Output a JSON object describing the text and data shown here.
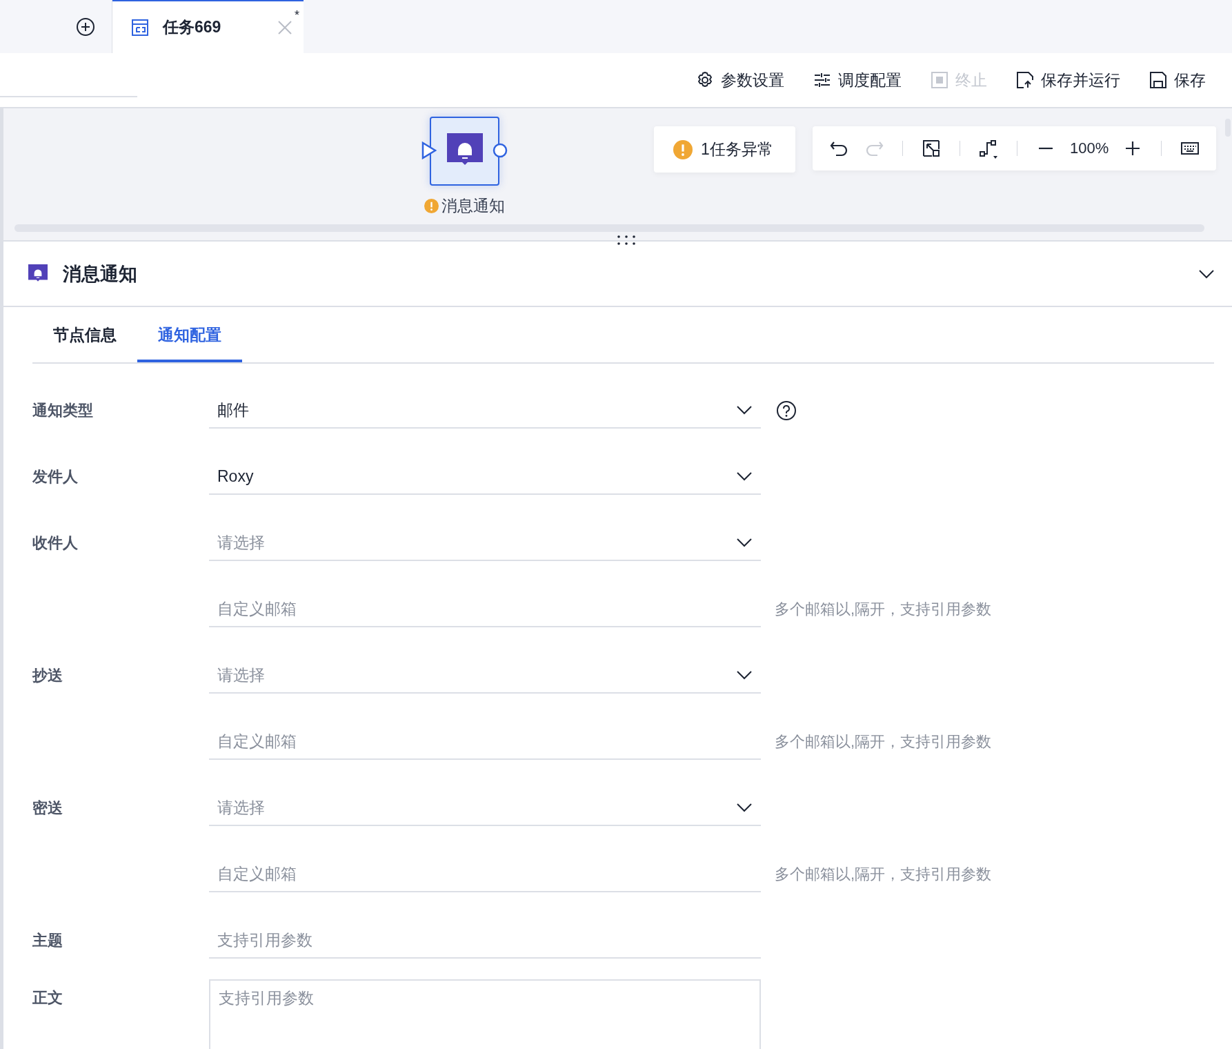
{
  "tabs": [
    {
      "title": "任务669",
      "modified_mark": "*",
      "selected": true
    }
  ],
  "actions": [
    {
      "kind": "settings",
      "label": "参数设置",
      "disabled": false
    },
    {
      "kind": "schedule",
      "label": "调度配置",
      "disabled": false
    },
    {
      "kind": "stop",
      "label": "终止",
      "disabled": true
    },
    {
      "kind": "save_run",
      "label": "保存并运行",
      "disabled": false
    },
    {
      "kind": "save",
      "label": "保存",
      "disabled": false
    }
  ],
  "canvas": {
    "node": {
      "label": "消息通知",
      "warning": true,
      "selected": true
    },
    "alert": "1任务异常",
    "tools": [
      {
        "kind": "undo",
        "disabled": false
      },
      {
        "kind": "redo",
        "disabled": true
      },
      {
        "kind": "fit",
        "disabled": false
      },
      {
        "kind": "connector",
        "disabled": false
      },
      {
        "kind": "zoom_out",
        "disabled": false
      },
      {
        "kind": "zoom_value",
        "text": "100%"
      },
      {
        "kind": "zoom_in",
        "disabled": false
      },
      {
        "kind": "keyboard",
        "disabled": false
      }
    ]
  },
  "panel": {
    "title": "消息通知",
    "expanded": true,
    "tabs": [
      {
        "label": "节点信息",
        "selected": false
      },
      {
        "label": "通知配置",
        "selected": true
      }
    ],
    "fields": [
      {
        "kind": "select",
        "label": "通知类型",
        "value": "邮件",
        "help": true
      },
      {
        "kind": "select",
        "label": "发件人",
        "value": "Roxy"
      },
      {
        "kind": "select",
        "label": "收件人",
        "placeholder": "请选择"
      },
      {
        "kind": "input",
        "placeholder": "自定义邮箱",
        "hint": "多个邮箱以,隔开，支持引用参数"
      },
      {
        "kind": "select",
        "label": "抄送",
        "placeholder": "请选择"
      },
      {
        "kind": "input",
        "placeholder": "自定义邮箱",
        "hint": "多个邮箱以,隔开，支持引用参数"
      },
      {
        "kind": "select",
        "label": "密送",
        "placeholder": "请选择"
      },
      {
        "kind": "input",
        "placeholder": "自定义邮箱",
        "hint": "多个邮箱以,隔开，支持引用参数"
      },
      {
        "kind": "input",
        "label": "主题",
        "placeholder": "支持引用参数"
      },
      {
        "kind": "textarea",
        "label": "正文",
        "placeholder": "支持引用参数"
      }
    ]
  }
}
